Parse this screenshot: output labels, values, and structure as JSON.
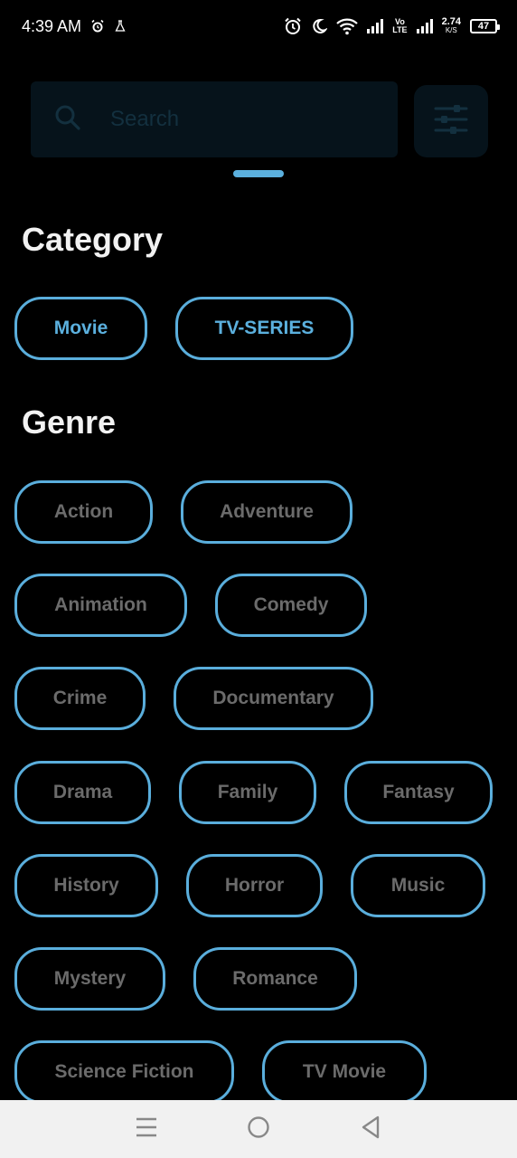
{
  "status_bar": {
    "time": "4:39 AM",
    "icons_left": [
      "alarm-icon",
      "flask-icon"
    ],
    "icons_right": [
      "alarm-icon",
      "moon-icon",
      "wifi-icon",
      "signal-icon",
      "volte-icon",
      "signal-icon"
    ],
    "volte_top": "Vo",
    "volte_bottom": "LTE",
    "net_speed": "2.74",
    "net_speed_unit": "K/S",
    "battery": "47"
  },
  "search": {
    "placeholder": "Search",
    "value": ""
  },
  "filter_icon": "sliders-icon",
  "category": {
    "title": "Category",
    "items": [
      {
        "label": "Movie",
        "selected": true
      },
      {
        "label": "TV-SERIES",
        "selected": true
      }
    ]
  },
  "genre": {
    "title": "Genre",
    "items": [
      {
        "label": "Action"
      },
      {
        "label": "Adventure"
      },
      {
        "label": "Animation"
      },
      {
        "label": "Comedy"
      },
      {
        "label": "Crime"
      },
      {
        "label": "Documentary"
      },
      {
        "label": "Drama"
      },
      {
        "label": "Family"
      },
      {
        "label": "Fantasy"
      },
      {
        "label": "History"
      },
      {
        "label": "Horror"
      },
      {
        "label": "Music"
      },
      {
        "label": "Mystery"
      },
      {
        "label": "Romance"
      },
      {
        "label": "Science Fiction"
      },
      {
        "label": "TV Movie"
      }
    ]
  },
  "colors": {
    "background": "#000000",
    "accent": "#5bb0de",
    "chip_text": "#6b6b6b",
    "nav_bar": "#f1f1f1"
  },
  "nav": [
    "menu-icon",
    "home-icon",
    "back-icon"
  ]
}
